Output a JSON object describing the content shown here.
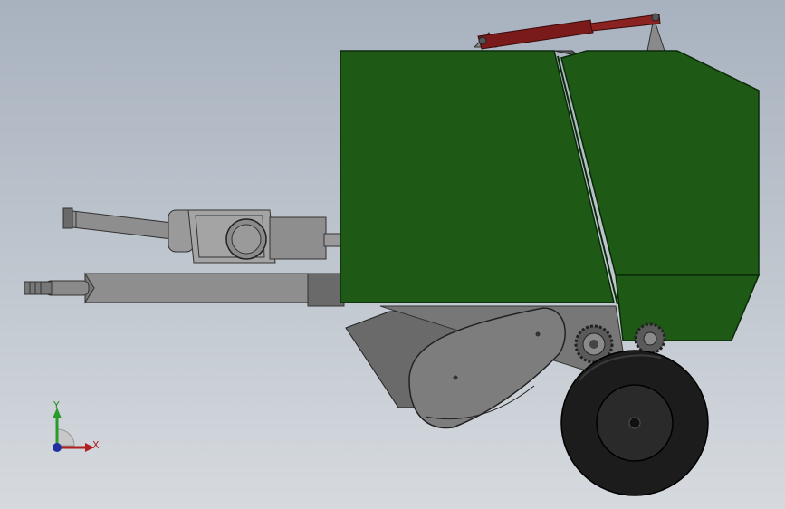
{
  "viewport": {
    "background_top": "#a8b2bf",
    "background_bottom": "#d6dadf"
  },
  "model": {
    "body_color": "#1e5a16",
    "cylinder_color": "#7a1a1a",
    "frame_color": "#8e8e8e",
    "dark_grey": "#6a6a6a",
    "tire_color": "#1c1c1c"
  },
  "triad": {
    "y_label": "Y",
    "x_label": "X",
    "y_color": "#2a9a2a",
    "x_color": "#b02020",
    "z_color": "#2030a0"
  }
}
